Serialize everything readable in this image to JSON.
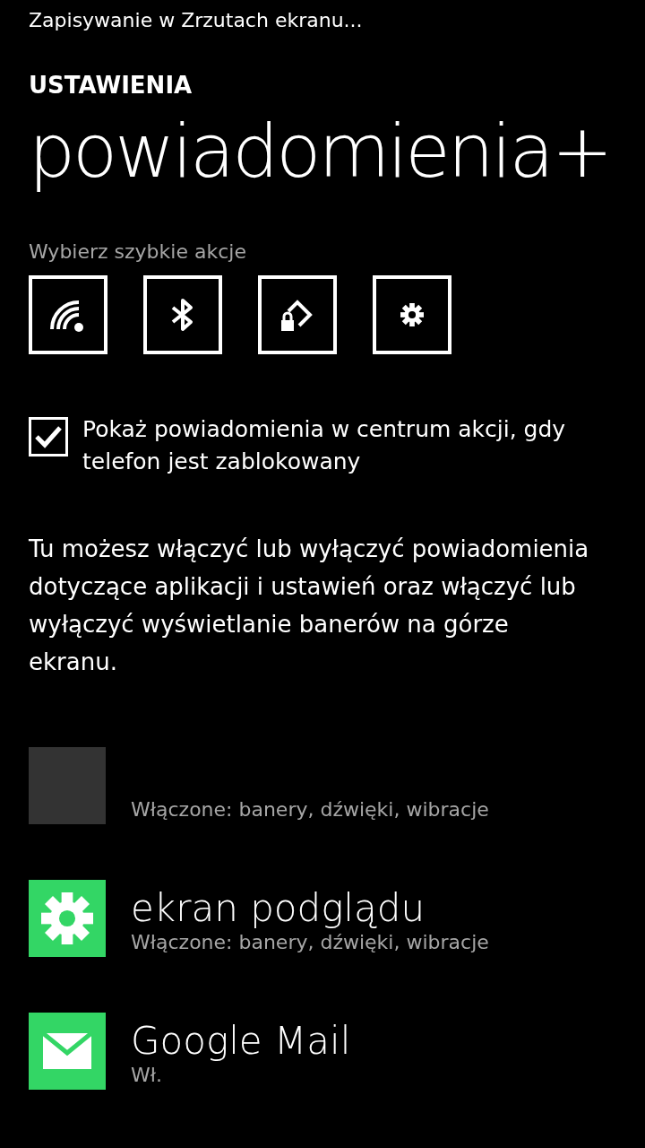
{
  "status_message": "Zapisywanie w Zrzutach ekranu...",
  "header": {
    "section": "USTAWIENIA",
    "title": "powiadomienia+"
  },
  "quick_actions": {
    "label": "Wybierz szybkie akcje",
    "tiles": [
      {
        "kind": "wifi"
      },
      {
        "kind": "bluetooth"
      },
      {
        "kind": "rotation-lock"
      },
      {
        "kind": "settings"
      }
    ]
  },
  "lock_screen_option": {
    "label": "Pokaż powiadomienia w centrum akcji, gdy telefon jest zablokowany",
    "checked": true
  },
  "description": "Tu możesz włączyć lub wyłączyć powiadomienia dotyczące aplikacji i ustawień oraz włączyć lub wyłączyć wyświetlanie banerów na górze ekranu.",
  "apps": [
    {
      "kind": "blank",
      "color": "#333333",
      "status": "Włączone: banery, dźwięki, wibracje"
    },
    {
      "kind": "gear",
      "color": "#33d665",
      "name": "ekran podglądu",
      "status": "Włączone: banery, dźwięki, wibracje"
    },
    {
      "kind": "mail",
      "color": "#33d665",
      "name": "Google Mail",
      "status": "Wł."
    }
  ]
}
